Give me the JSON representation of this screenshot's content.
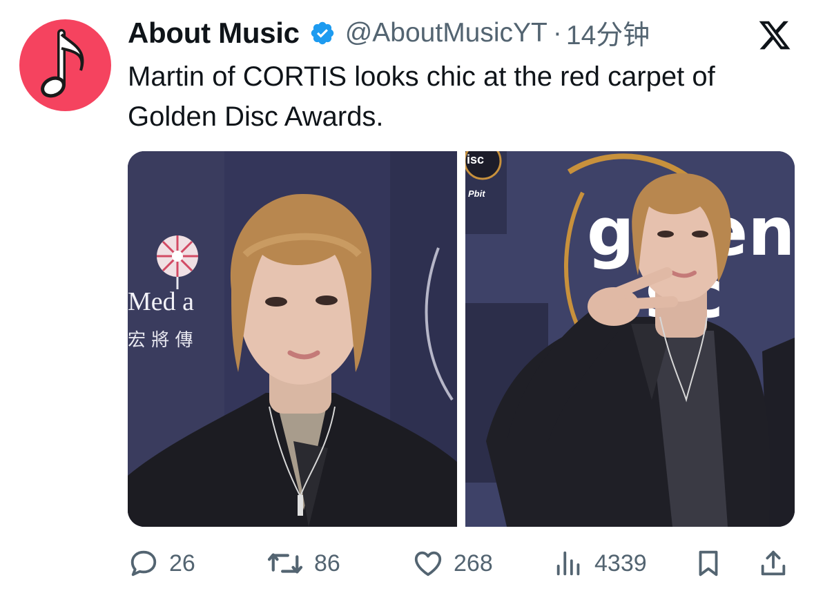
{
  "tweet": {
    "author_name": "About Music",
    "handle": "@AboutMusicYT",
    "separator": "·",
    "time": "14分钟",
    "text": "Martin of CORTIS looks chic at the red carpet of Golden Disc Awards."
  },
  "media": {
    "left": {
      "backdrop_text_1": "Med a",
      "backdrop_text_2": "宏 將 傳"
    },
    "right": {
      "backdrop_logo_1": "isc",
      "backdrop_logo_2": "Pbit",
      "backdrop_big_1": "go en",
      "backdrop_big_2": "sc"
    }
  },
  "actions": {
    "replies": "26",
    "reposts": "86",
    "likes": "268",
    "views": "4339"
  },
  "colors": {
    "avatar_bg": "#f5435f",
    "verified": "#1d9bf0",
    "muted_text": "#536471",
    "text": "#0f1419"
  },
  "icons": [
    "music-note-icon",
    "verified-badge-icon",
    "x-logo-icon",
    "reply-icon",
    "repost-icon",
    "like-icon",
    "views-icon",
    "bookmark-icon",
    "share-icon"
  ]
}
